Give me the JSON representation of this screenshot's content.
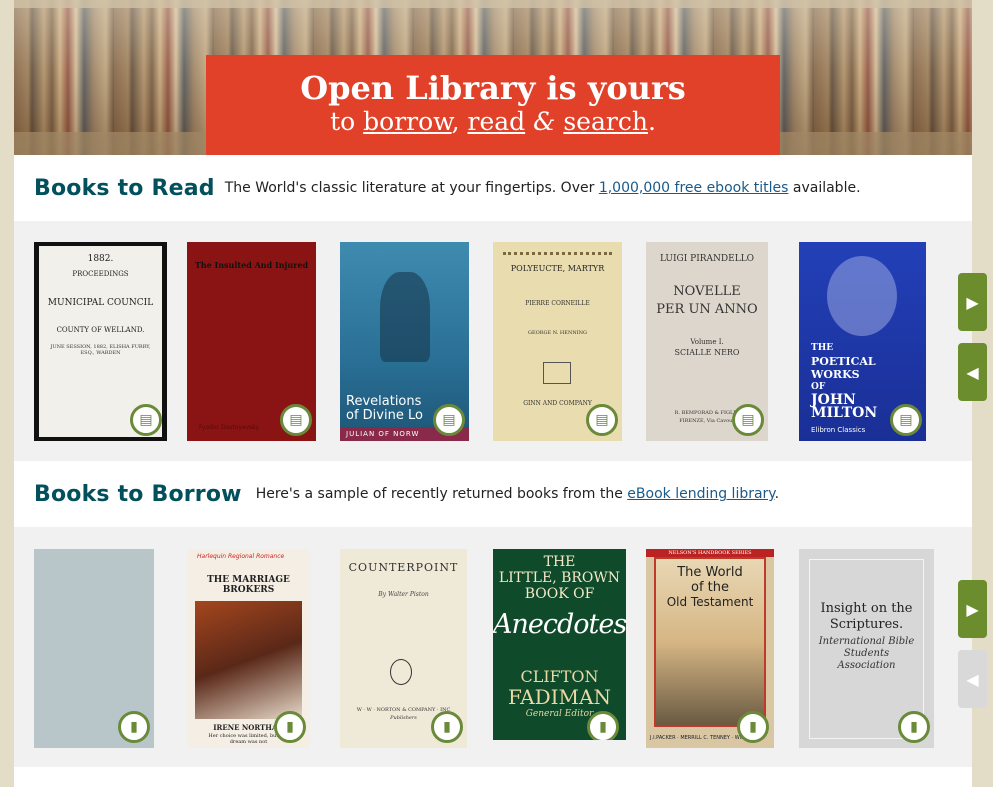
{
  "hero": {
    "title": "Open Library is yours",
    "sub_to": "to",
    "borrow": "borrow",
    "comma": ",",
    "read": "read",
    "amp": "&",
    "search": "search",
    "period": "."
  },
  "books_to_read": {
    "title": "Books to Read",
    "desc_pre": "The World's classic literature at your fingertips. Over",
    "link": "1,000,000 free ebook titles",
    "desc_post": "available.",
    "covers": [
      {
        "lines": [
          "1882.",
          "PROCEEDINGS",
          "MUNICIPAL COUNCIL",
          "COUNTY OF WELLAND.",
          "JUNE SESSION, 1882, ELISHA FURRY, ESQ., WARDEN"
        ]
      },
      {
        "lines": [
          "The Insulted And Injured",
          "Fyodor Dostoyevsky"
        ]
      },
      {
        "lines": [
          "Revelations",
          "of Divine Lo",
          "JULIAN OF NORW"
        ]
      },
      {
        "lines": [
          "POLYEUCTE, MARTYR",
          "PIERRE CORNEILLE",
          "GEORGE N. HENNING",
          "GINN AND COMPANY"
        ]
      },
      {
        "lines": [
          "LUIGI PIRANDELLO",
          "NOVELLE",
          "PER UN ANNO",
          "Volume I.",
          "SCIALLE NERO",
          "R. BEMPORAD & FIGLIO",
          "FIRENZE, Via Cavour"
        ]
      },
      {
        "lines": [
          "THE",
          "POETICAL",
          "WORKS",
          "OF",
          "JOHN",
          "MILTON",
          "Elibron Classics"
        ]
      }
    ]
  },
  "books_to_borrow": {
    "title": "Books to Borrow",
    "desc_pre": "Here's a sample of recently returned books from the",
    "link": "eBook lending library",
    "desc_post": ".",
    "covers": [
      {
        "lines": []
      },
      {
        "lines": [
          "Harlequin Regional Romance",
          "THE MARRIAGE BROKERS",
          "IRENE NORTHAN",
          "Her choice was limited, but her dream was not"
        ]
      },
      {
        "lines": [
          "COUNTERPOINT",
          "By Walter Piston",
          "W · W · NORTON & COMPANY · INC",
          "Publishers"
        ]
      },
      {
        "lines": [
          "THE",
          "LITTLE, BROWN",
          "BOOK OF",
          "Anecdotes",
          "CLIFTON",
          "FADIMAN",
          "General Editor"
        ]
      },
      {
        "lines": [
          "NELSON'S HANDBOOK SERIES",
          "The World",
          "of the",
          "Old Testament",
          "J.I.PACKER · MERRILL C. TENNEY · WILLIAM"
        ]
      },
      {
        "lines": [
          "Insight on the",
          "Scriptures.",
          "International Bible",
          "Students",
          "Association"
        ]
      }
    ]
  },
  "icons": {
    "read_badge": "open-book-icon",
    "borrow_badge": "book-icon",
    "next": "arrow-right-icon",
    "prev": "arrow-left-icon"
  },
  "colors": {
    "accent_red": "#e04128",
    "heading_teal": "#02505c",
    "arrow_green": "#6b8d2d",
    "badge_green": "#6a8a3a",
    "link_blue": "#1a5a8a"
  }
}
